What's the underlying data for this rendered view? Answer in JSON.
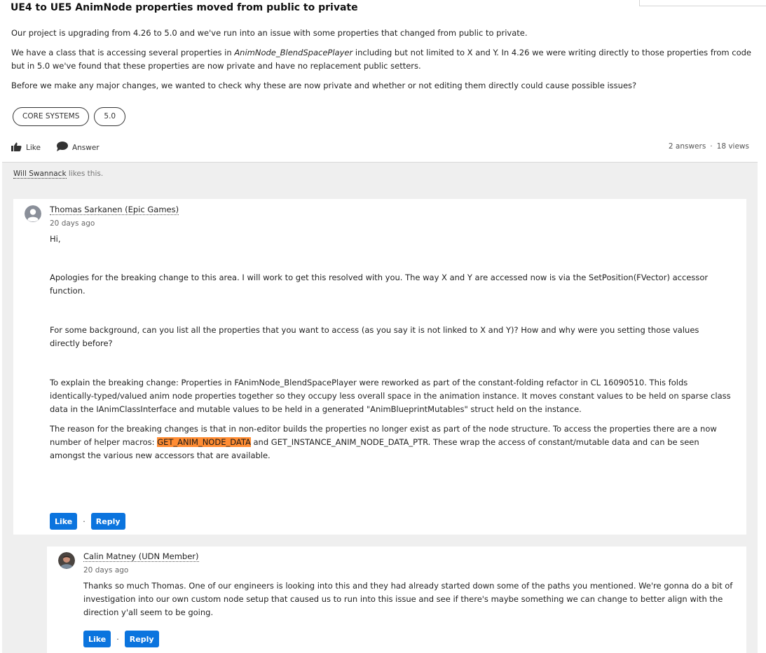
{
  "question": {
    "title": "UE4 to UE5 AnimNode properties moved from public to private",
    "para1": "Our project is upgrading from 4.26 to 5.0 and we've run into an issue with some properties that changed from public to private.",
    "para2_before": "We have a class that is accessing several properties in ",
    "para2_class": "AnimNode_BlendSpacePlayer",
    "para2_after": " including but not limited to X and Y. In 4.26 we were writing directly to those properties from code but in 5.0 we've found that these properties are now private and have no replacement public setters.",
    "para3": "Before we make any major changes, we wanted to check why these are now private and whether or not editing them directly could cause possible issues?",
    "tags": [
      "CORE SYSTEMS",
      "5.0"
    ],
    "like_label": "Like",
    "answer_label": "Answer",
    "answers_count": "2 answers",
    "views_count": "18 views",
    "stats_dot": "·"
  },
  "likes": {
    "user": "Will Swannack",
    "text": " likes this."
  },
  "answer1": {
    "author": "Thomas Sarkanen (Epic Games)",
    "date": "20 days ago",
    "p1": "Hi,",
    "p2": "Apologies for the breaking change to this area. I will work to get this resolved with you. The way X and Y are accessed now is via the SetPosition(FVector) accessor function.",
    "p3": "For some background, can you list all the properties that you want to access (as you say it is not linked to X and Y)? How and why were you setting those values directly before?",
    "p4": "To explain the breaking change: Properties in FAnimNode_BlendSpacePlayer were reworked as part of the constant-folding refactor in CL 16090510. This folds identically-typed/valued anim node properties together so they occupy less overall space in the animation instance. It moves constant values to be held on sparse class data in the IAnimClassInterface and mutable values to be held in a generated \"AnimBlueprintMutables\" struct held on the instance.",
    "p5_before": "The reason for the breaking changes is that in non-editor builds the properties no longer exist as part of the node structure. To access the properties there are a now number of helper macros: ",
    "p5_highlight": "GET_ANIM_NODE_DATA",
    "p5_after": " and GET_INSTANCE_ANIM_NODE_DATA_PTR. These wrap the access of constant/mutable data and can be seen amongst the various new accessors that are available.",
    "like_label": "Like",
    "sep": "·",
    "reply_label": "Reply"
  },
  "reply1": {
    "author": "Calin Matney (UDN Member)",
    "date": "20 days ago",
    "text": "Thanks so much Thomas. One of our engineers is looking into this and they had already started down some of the paths you mentioned. We're gonna do a bit of investigation into our own custom node setup that caused us to run into this issue and see if there's maybe something we can change to better align with the direction y'all seem to be going.",
    "like_label": "Like",
    "sep": "·",
    "reply_label": "Reply"
  },
  "colors": {
    "accent": "#0b74de",
    "highlight": "#ff8c33",
    "activity_bg": "#efefef"
  },
  "icons": [
    "thumbs-up-icon",
    "speech-bubble-icon",
    "user-avatar-icon"
  ]
}
